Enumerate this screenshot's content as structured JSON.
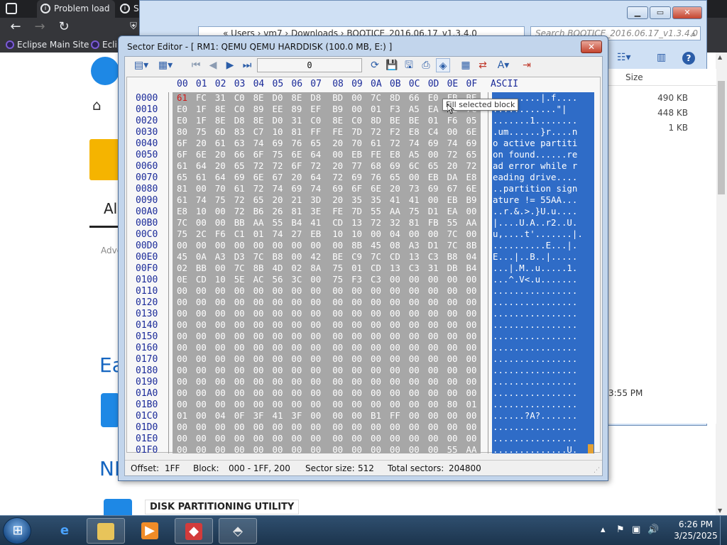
{
  "browser": {
    "tabs": [
      {
        "label": "Problem load"
      },
      {
        "label": "S"
      }
    ],
    "bookmarks": [
      "Eclipse Main Site",
      "Eclip"
    ],
    "page": {
      "all_label": "All",
      "adve_label": "Adve",
      "ea_label": "Ea",
      "nl_label": "NI",
      "banner_label": "DISK PARTITIONING UTILITY"
    }
  },
  "explorer": {
    "address": "« Users › vm7 › Downloads › BOOTICE_2016.06.17_v1.3.4.0",
    "search_placeholder": "Search BOOTICE_2016.06.17_v1.3.4.0",
    "size_header": "Size",
    "sizes": [
      "490 KB",
      "448 KB",
      "1 KB"
    ],
    "time": "3:55 PM"
  },
  "dialog": {
    "title": "Sector Editor - [ RM1: QEMU QEMU HARDDISK (100.0 MB, E:) ]",
    "sector_value": "0",
    "tooltip": "Fill selected block",
    "ascii_header": "ASCII",
    "col_headers": [
      "00",
      "01",
      "02",
      "03",
      "04",
      "05",
      "06",
      "07",
      "08",
      "09",
      "0A",
      "0B",
      "0C",
      "0D",
      "0E",
      "0F"
    ],
    "offsets": [
      "0000",
      "0010",
      "0020",
      "0030",
      "0040",
      "0050",
      "0060",
      "0070",
      "0080",
      "0090",
      "00A0",
      "00B0",
      "00C0",
      "00D0",
      "00E0",
      "00F0",
      "0100",
      "0110",
      "0120",
      "0130",
      "0140",
      "0150",
      "0160",
      "0170",
      "0180",
      "0190",
      "01A0",
      "01B0",
      "01C0",
      "01D0",
      "01E0",
      "01F0"
    ],
    "hex_rows": [
      [
        "61",
        "FC",
        "31",
        "C0",
        "8E",
        "D0",
        "8E",
        "D8",
        "BD",
        "00",
        "7C",
        "8D",
        "66",
        "E0",
        "FB",
        "BE"
      ],
      [
        "E0",
        "1F",
        "8E",
        "C0",
        "89",
        "EE",
        "89",
        "EF",
        "B9",
        "00",
        "01",
        "F3",
        "A5",
        "EA",
        "22",
        "7C"
      ],
      [
        "E0",
        "1F",
        "8E",
        "D8",
        "8E",
        "D0",
        "31",
        "C0",
        "8E",
        "C0",
        "8D",
        "BE",
        "BE",
        "01",
        "F6",
        "05"
      ],
      [
        "80",
        "75",
        "6D",
        "83",
        "C7",
        "10",
        "81",
        "FF",
        "FE",
        "7D",
        "72",
        "F2",
        "E8",
        "C4",
        "00",
        "6E"
      ],
      [
        "6F",
        "20",
        "61",
        "63",
        "74",
        "69",
        "76",
        "65",
        "20",
        "70",
        "61",
        "72",
        "74",
        "69",
        "74",
        "69"
      ],
      [
        "6F",
        "6E",
        "20",
        "66",
        "6F",
        "75",
        "6E",
        "64",
        "00",
        "EB",
        "FE",
        "E8",
        "A5",
        "00",
        "72",
        "65"
      ],
      [
        "61",
        "64",
        "20",
        "65",
        "72",
        "72",
        "6F",
        "72",
        "20",
        "77",
        "68",
        "69",
        "6C",
        "65",
        "20",
        "72"
      ],
      [
        "65",
        "61",
        "64",
        "69",
        "6E",
        "67",
        "20",
        "64",
        "72",
        "69",
        "76",
        "65",
        "00",
        "EB",
        "DA",
        "E8"
      ],
      [
        "81",
        "00",
        "70",
        "61",
        "72",
        "74",
        "69",
        "74",
        "69",
        "6F",
        "6E",
        "20",
        "73",
        "69",
        "67",
        "6E"
      ],
      [
        "61",
        "74",
        "75",
        "72",
        "65",
        "20",
        "21",
        "3D",
        "20",
        "35",
        "35",
        "41",
        "41",
        "00",
        "EB",
        "B9"
      ],
      [
        "E8",
        "10",
        "00",
        "72",
        "B6",
        "26",
        "81",
        "3E",
        "FE",
        "7D",
        "55",
        "AA",
        "75",
        "D1",
        "EA",
        "00"
      ],
      [
        "7C",
        "00",
        "00",
        "BB",
        "AA",
        "55",
        "B4",
        "41",
        "CD",
        "13",
        "72",
        "32",
        "81",
        "FB",
        "55",
        "AA"
      ],
      [
        "75",
        "2C",
        "F6",
        "C1",
        "01",
        "74",
        "27",
        "EB",
        "10",
        "10",
        "00",
        "04",
        "00",
        "00",
        "7C",
        "00"
      ],
      [
        "00",
        "00",
        "00",
        "00",
        "00",
        "00",
        "00",
        "00",
        "00",
        "8B",
        "45",
        "08",
        "A3",
        "D1",
        "7C",
        "8B"
      ],
      [
        "45",
        "0A",
        "A3",
        "D3",
        "7C",
        "B8",
        "00",
        "42",
        "BE",
        "C9",
        "7C",
        "CD",
        "13",
        "C3",
        "B8",
        "04"
      ],
      [
        "02",
        "BB",
        "00",
        "7C",
        "8B",
        "4D",
        "02",
        "8A",
        "75",
        "01",
        "CD",
        "13",
        "C3",
        "31",
        "DB",
        "B4"
      ],
      [
        "0E",
        "CD",
        "10",
        "5E",
        "AC",
        "56",
        "3C",
        "00",
        "75",
        "F3",
        "C3",
        "00",
        "00",
        "00",
        "00",
        "00"
      ],
      [
        "00",
        "00",
        "00",
        "00",
        "00",
        "00",
        "00",
        "00",
        "00",
        "00",
        "00",
        "00",
        "00",
        "00",
        "00",
        "00"
      ],
      [
        "00",
        "00",
        "00",
        "00",
        "00",
        "00",
        "00",
        "00",
        "00",
        "00",
        "00",
        "00",
        "00",
        "00",
        "00",
        "00"
      ],
      [
        "00",
        "00",
        "00",
        "00",
        "00",
        "00",
        "00",
        "00",
        "00",
        "00",
        "00",
        "00",
        "00",
        "00",
        "00",
        "00"
      ],
      [
        "00",
        "00",
        "00",
        "00",
        "00",
        "00",
        "00",
        "00",
        "00",
        "00",
        "00",
        "00",
        "00",
        "00",
        "00",
        "00"
      ],
      [
        "00",
        "00",
        "00",
        "00",
        "00",
        "00",
        "00",
        "00",
        "00",
        "00",
        "00",
        "00",
        "00",
        "00",
        "00",
        "00"
      ],
      [
        "00",
        "00",
        "00",
        "00",
        "00",
        "00",
        "00",
        "00",
        "00",
        "00",
        "00",
        "00",
        "00",
        "00",
        "00",
        "00"
      ],
      [
        "00",
        "00",
        "00",
        "00",
        "00",
        "00",
        "00",
        "00",
        "00",
        "00",
        "00",
        "00",
        "00",
        "00",
        "00",
        "00"
      ],
      [
        "00",
        "00",
        "00",
        "00",
        "00",
        "00",
        "00",
        "00",
        "00",
        "00",
        "00",
        "00",
        "00",
        "00",
        "00",
        "00"
      ],
      [
        "00",
        "00",
        "00",
        "00",
        "00",
        "00",
        "00",
        "00",
        "00",
        "00",
        "00",
        "00",
        "00",
        "00",
        "00",
        "00"
      ],
      [
        "00",
        "00",
        "00",
        "00",
        "00",
        "00",
        "00",
        "00",
        "00",
        "00",
        "00",
        "00",
        "00",
        "00",
        "00",
        "00"
      ],
      [
        "00",
        "00",
        "00",
        "00",
        "00",
        "00",
        "00",
        "00",
        "00",
        "00",
        "00",
        "00",
        "00",
        "00",
        "80",
        "01"
      ],
      [
        "01",
        "00",
        "04",
        "0F",
        "3F",
        "41",
        "3F",
        "00",
        "00",
        "00",
        "B1",
        "FF",
        "00",
        "00",
        "00",
        "00"
      ],
      [
        "00",
        "00",
        "00",
        "00",
        "00",
        "00",
        "00",
        "00",
        "00",
        "00",
        "00",
        "00",
        "00",
        "00",
        "00",
        "00"
      ],
      [
        "00",
        "00",
        "00",
        "00",
        "00",
        "00",
        "00",
        "00",
        "00",
        "00",
        "00",
        "00",
        "00",
        "00",
        "00",
        "00"
      ],
      [
        "00",
        "00",
        "00",
        "00",
        "00",
        "00",
        "00",
        "00",
        "00",
        "00",
        "00",
        "00",
        "00",
        "00",
        "55",
        "AA"
      ]
    ],
    "ascii_rows": [
      ".........|.f....",
      "............\"|",
      ".......1........",
      ".um......}r....n",
      "o active partiti",
      "on found......re",
      "ad error while r",
      "eading drive....",
      "..partition sign",
      "ature != 55AA...",
      "..r.&.>.}U.u....",
      "|....U.A..r2..U.",
      "u,....t'.......|.",
      "..........E...|.",
      "E...|..B..|.....",
      "...|.M..u.....1.",
      "...^.V<.u.......",
      "................",
      "................",
      "................",
      "................",
      "................",
      "................",
      "................",
      "................",
      "................",
      "................",
      "................",
      "......?A?.......",
      "................",
      "................",
      "..............U."
    ],
    "status": {
      "offset_label": "Offset:",
      "offset_value": "1FF",
      "block_label": "Block:",
      "block_value": "000 - 1FF, 200",
      "sector_size_label": "Sector size:",
      "sector_size_value": "512",
      "total_label": "Total sectors:",
      "total_value": "204800"
    }
  },
  "taskbar": {
    "clock_time": "6:26 PM",
    "clock_date": "3/25/2025"
  },
  "colors": {
    "hex_bg": "#a7a7a7",
    "ascii_bg": "#2f6cc7",
    "offset_text": "#1a2a99",
    "first_byte": "#d21515"
  }
}
